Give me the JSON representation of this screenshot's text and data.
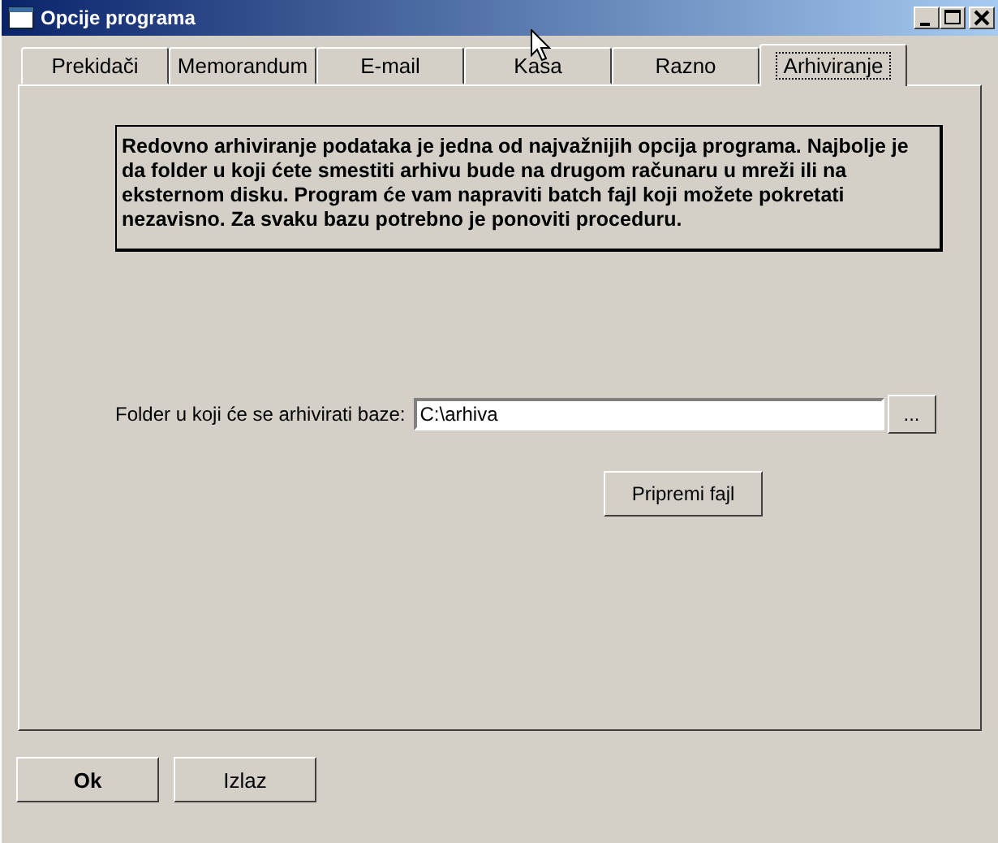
{
  "window": {
    "title": "Opcije programa"
  },
  "tabs": [
    {
      "label": "Prekidači",
      "selected": false
    },
    {
      "label": "Memorandum",
      "selected": false
    },
    {
      "label": "E-mail",
      "selected": false
    },
    {
      "label": "Kasa",
      "selected": false
    },
    {
      "label": "Razno",
      "selected": false
    },
    {
      "label": "Arhiviranje",
      "selected": true
    }
  ],
  "info_text": "Redovno arhiviranje podataka je jedna od najvažnijih opcija programa. Najbolje je da folder u koji ćete smestiti arhivu bude na drugom računaru u mreži ili na eksternom disku. Program će vam napraviti batch fajl koji možete pokretati nezavisno. Za svaku bazu potrebno je ponoviti proceduru.",
  "folder": {
    "label": "Folder u koji će se arhivirati baze:",
    "value": "C:\\arhiva",
    "browse": "..."
  },
  "prepare_button": "Pripremi fajl",
  "buttons": [
    {
      "label": "Ok",
      "default": true
    },
    {
      "label": "Izlaz",
      "default": false
    }
  ]
}
